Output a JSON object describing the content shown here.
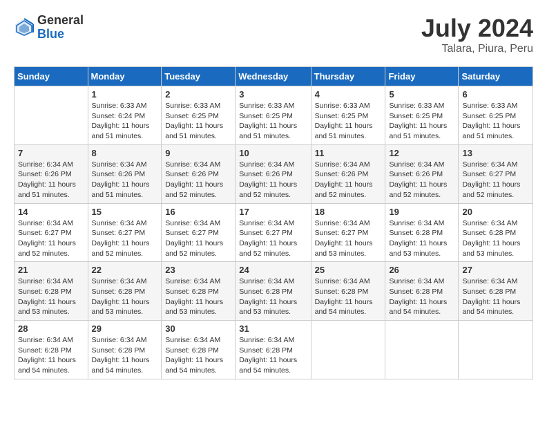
{
  "logo": {
    "general": "General",
    "blue": "Blue"
  },
  "title": "July 2024",
  "location": "Talara, Piura, Peru",
  "days_of_week": [
    "Sunday",
    "Monday",
    "Tuesday",
    "Wednesday",
    "Thursday",
    "Friday",
    "Saturday"
  ],
  "weeks": [
    [
      {
        "day": "",
        "info": ""
      },
      {
        "day": "1",
        "info": "Sunrise: 6:33 AM\nSunset: 6:24 PM\nDaylight: 11 hours and 51 minutes."
      },
      {
        "day": "2",
        "info": "Sunrise: 6:33 AM\nSunset: 6:25 PM\nDaylight: 11 hours and 51 minutes."
      },
      {
        "day": "3",
        "info": "Sunrise: 6:33 AM\nSunset: 6:25 PM\nDaylight: 11 hours and 51 minutes."
      },
      {
        "day": "4",
        "info": "Sunrise: 6:33 AM\nSunset: 6:25 PM\nDaylight: 11 hours and 51 minutes."
      },
      {
        "day": "5",
        "info": "Sunrise: 6:33 AM\nSunset: 6:25 PM\nDaylight: 11 hours and 51 minutes."
      },
      {
        "day": "6",
        "info": "Sunrise: 6:33 AM\nSunset: 6:25 PM\nDaylight: 11 hours and 51 minutes."
      }
    ],
    [
      {
        "day": "7",
        "info": "Sunrise: 6:34 AM\nSunset: 6:26 PM\nDaylight: 11 hours and 51 minutes."
      },
      {
        "day": "8",
        "info": "Sunrise: 6:34 AM\nSunset: 6:26 PM\nDaylight: 11 hours and 51 minutes."
      },
      {
        "day": "9",
        "info": "Sunrise: 6:34 AM\nSunset: 6:26 PM\nDaylight: 11 hours and 52 minutes."
      },
      {
        "day": "10",
        "info": "Sunrise: 6:34 AM\nSunset: 6:26 PM\nDaylight: 11 hours and 52 minutes."
      },
      {
        "day": "11",
        "info": "Sunrise: 6:34 AM\nSunset: 6:26 PM\nDaylight: 11 hours and 52 minutes."
      },
      {
        "day": "12",
        "info": "Sunrise: 6:34 AM\nSunset: 6:26 PM\nDaylight: 11 hours and 52 minutes."
      },
      {
        "day": "13",
        "info": "Sunrise: 6:34 AM\nSunset: 6:27 PM\nDaylight: 11 hours and 52 minutes."
      }
    ],
    [
      {
        "day": "14",
        "info": "Sunrise: 6:34 AM\nSunset: 6:27 PM\nDaylight: 11 hours and 52 minutes."
      },
      {
        "day": "15",
        "info": "Sunrise: 6:34 AM\nSunset: 6:27 PM\nDaylight: 11 hours and 52 minutes."
      },
      {
        "day": "16",
        "info": "Sunrise: 6:34 AM\nSunset: 6:27 PM\nDaylight: 11 hours and 52 minutes."
      },
      {
        "day": "17",
        "info": "Sunrise: 6:34 AM\nSunset: 6:27 PM\nDaylight: 11 hours and 52 minutes."
      },
      {
        "day": "18",
        "info": "Sunrise: 6:34 AM\nSunset: 6:27 PM\nDaylight: 11 hours and 53 minutes."
      },
      {
        "day": "19",
        "info": "Sunrise: 6:34 AM\nSunset: 6:28 PM\nDaylight: 11 hours and 53 minutes."
      },
      {
        "day": "20",
        "info": "Sunrise: 6:34 AM\nSunset: 6:28 PM\nDaylight: 11 hours and 53 minutes."
      }
    ],
    [
      {
        "day": "21",
        "info": "Sunrise: 6:34 AM\nSunset: 6:28 PM\nDaylight: 11 hours and 53 minutes."
      },
      {
        "day": "22",
        "info": "Sunrise: 6:34 AM\nSunset: 6:28 PM\nDaylight: 11 hours and 53 minutes."
      },
      {
        "day": "23",
        "info": "Sunrise: 6:34 AM\nSunset: 6:28 PM\nDaylight: 11 hours and 53 minutes."
      },
      {
        "day": "24",
        "info": "Sunrise: 6:34 AM\nSunset: 6:28 PM\nDaylight: 11 hours and 53 minutes."
      },
      {
        "day": "25",
        "info": "Sunrise: 6:34 AM\nSunset: 6:28 PM\nDaylight: 11 hours and 54 minutes."
      },
      {
        "day": "26",
        "info": "Sunrise: 6:34 AM\nSunset: 6:28 PM\nDaylight: 11 hours and 54 minutes."
      },
      {
        "day": "27",
        "info": "Sunrise: 6:34 AM\nSunset: 6:28 PM\nDaylight: 11 hours and 54 minutes."
      }
    ],
    [
      {
        "day": "28",
        "info": "Sunrise: 6:34 AM\nSunset: 6:28 PM\nDaylight: 11 hours and 54 minutes."
      },
      {
        "day": "29",
        "info": "Sunrise: 6:34 AM\nSunset: 6:28 PM\nDaylight: 11 hours and 54 minutes."
      },
      {
        "day": "30",
        "info": "Sunrise: 6:34 AM\nSunset: 6:28 PM\nDaylight: 11 hours and 54 minutes."
      },
      {
        "day": "31",
        "info": "Sunrise: 6:34 AM\nSunset: 6:28 PM\nDaylight: 11 hours and 54 minutes."
      },
      {
        "day": "",
        "info": ""
      },
      {
        "day": "",
        "info": ""
      },
      {
        "day": "",
        "info": ""
      }
    ]
  ]
}
